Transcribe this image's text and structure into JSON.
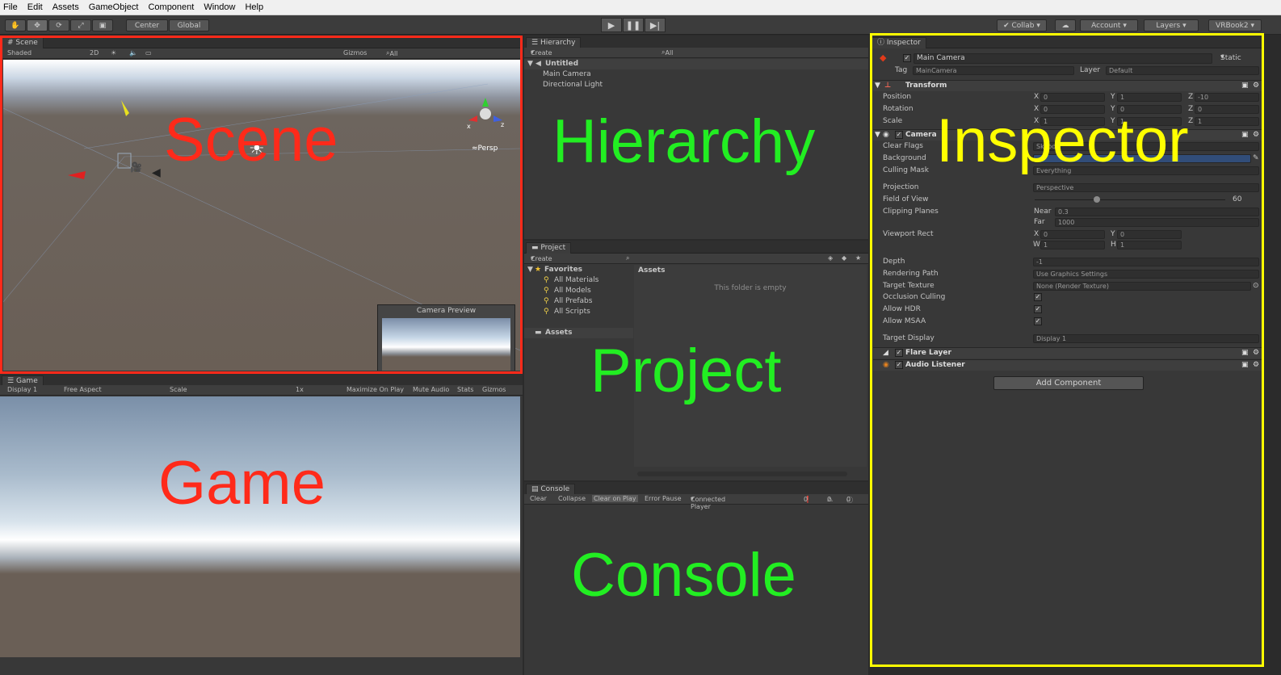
{
  "menu": [
    "File",
    "Edit",
    "Assets",
    "GameObject",
    "Component",
    "Window",
    "Help"
  ],
  "toolbar": {
    "pivot": "Center",
    "space": "Global",
    "collab": "Collab",
    "account": "Account",
    "layers": "Layers",
    "layout": "VRBook2"
  },
  "scene": {
    "tab": "Scene",
    "shading": "Shaded",
    "mode2d": "2D",
    "gizmos": "Gizmos",
    "search": "All",
    "persp": "Persp",
    "preview_title": "Camera Preview",
    "overlay": "Scene"
  },
  "game": {
    "tab": "Game",
    "display": "Display 1",
    "aspect": "Free Aspect",
    "scale_label": "Scale",
    "scale_value": "1x",
    "maximize": "Maximize On Play",
    "mute": "Mute Audio",
    "stats": "Stats",
    "gizmos": "Gizmos",
    "overlay": "Game"
  },
  "hierarchy": {
    "tab": "Hierarchy",
    "create": "Create",
    "search": "All",
    "scene_name": "Untitled",
    "items": [
      "Main Camera",
      "Directional Light"
    ],
    "overlay": "Hierarchy"
  },
  "project": {
    "tab": "Project",
    "create": "Create",
    "favorites": "Favorites",
    "fav_items": [
      "All Materials",
      "All Models",
      "All Prefabs",
      "All Scripts"
    ],
    "assets_folder": "Assets",
    "assets_header": "Assets",
    "empty": "This folder is empty",
    "overlay": "Project"
  },
  "console": {
    "tab": "Console",
    "clear": "Clear",
    "collapse": "Collapse",
    "clear_on_play": "Clear on Play",
    "error_pause": "Error Pause",
    "connected": "Connected Player",
    "errors": "0",
    "warnings": "0",
    "logs": "0",
    "overlay": "Console"
  },
  "inspector": {
    "tab": "Inspector",
    "object_name": "Main Camera",
    "static": "Static",
    "tag_label": "Tag",
    "tag_value": "MainCamera",
    "layer_label": "Layer",
    "layer_value": "Default",
    "transform": {
      "title": "Transform",
      "rows": [
        {
          "label": "Position",
          "x": "0",
          "y": "1",
          "z": "-10"
        },
        {
          "label": "Rotation",
          "x": "0",
          "y": "0",
          "z": "0"
        },
        {
          "label": "Scale",
          "x": "1",
          "y": "1",
          "z": "1"
        }
      ]
    },
    "camera": {
      "title": "Camera",
      "clear_flags": "Clear Flags",
      "clear_flags_value": "Skybox",
      "background": "Background",
      "culling_mask": "Culling Mask",
      "culling_mask_value": "Everything",
      "projection": "Projection",
      "projection_value": "Perspective",
      "fov": "Field of View",
      "fov_value": "60",
      "clipping": "Clipping Planes",
      "near_label": "Near",
      "near_value": "0.3",
      "far_label": "Far",
      "far_value": "1000",
      "viewport": "Viewport Rect",
      "vx": "0",
      "vy": "0",
      "vw": "1",
      "vh": "1",
      "depth": "Depth",
      "depth_value": "-1",
      "rendering_path": "Rendering Path",
      "rendering_path_value": "Use Graphics Settings",
      "target_texture": "Target Texture",
      "target_texture_value": "None (Render Texture)",
      "occlusion": "Occlusion Culling",
      "hdr": "Allow HDR",
      "msaa": "Allow MSAA",
      "target_display": "Target Display",
      "target_display_value": "Display 1"
    },
    "flare_layer": "Flare Layer",
    "audio_listener": "Audio Listener",
    "add_component": "Add Component",
    "overlay": "Inspector"
  },
  "colors": {
    "scene_outline": "#ff2a1a",
    "inspector_outline": "#ffff00",
    "overlay_red": "#ff2a1a",
    "overlay_green": "#22ee22",
    "overlay_yellow": "#ffff00"
  }
}
